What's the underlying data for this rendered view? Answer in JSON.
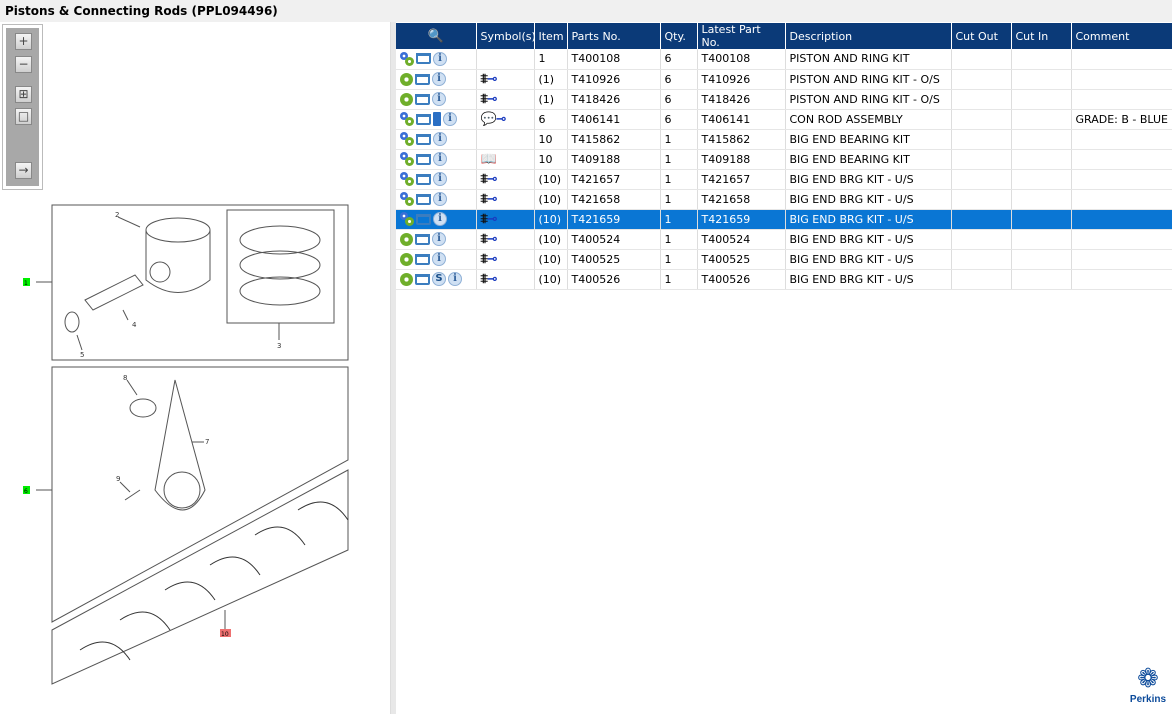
{
  "title": "Pistons & Connecting Rods (PPL094496)",
  "toolbar": {
    "zoom_in": "+",
    "zoom_out": "−",
    "fit": "⊞",
    "single": "□",
    "export": "→"
  },
  "diagram": {
    "callouts": [
      "2",
      "4",
      "5",
      "3",
      "8",
      "7",
      "9"
    ],
    "markers": [
      "1",
      "6",
      "10"
    ]
  },
  "table": {
    "headers": [
      "",
      "Symbol(s)",
      "Item",
      "Parts No.",
      "Qty.",
      "Latest Part No.",
      "Description",
      "Cut Out",
      "Cut In",
      "Comment"
    ],
    "rows": [
      {
        "icons": "gears",
        "extra": "",
        "sym": "",
        "item": "1",
        "part": "T400108",
        "qty": "6",
        "latest": "T400108",
        "desc": "PISTON AND RING KIT",
        "comment": ""
      },
      {
        "icons": "gear",
        "extra": "",
        "sym": "std",
        "item": "(1)",
        "part": "T410926",
        "qty": "6",
        "latest": "T410926",
        "desc": "PISTON AND RING KIT - O/S",
        "comment": ""
      },
      {
        "icons": "gear",
        "extra": "",
        "sym": "std",
        "item": "(1)",
        "part": "T418426",
        "qty": "6",
        "latest": "T418426",
        "desc": "PISTON AND RING KIT - O/S",
        "comment": ""
      },
      {
        "icons": "gears",
        "extra": "book",
        "sym": "note",
        "item": "6",
        "part": "T406141",
        "qty": "6",
        "latest": "T406141",
        "desc": "CON ROD ASSEMBLY",
        "comment": "GRADE: B - BLUE"
      },
      {
        "icons": "gears",
        "extra": "",
        "sym": "",
        "item": "10",
        "part": "T415862",
        "qty": "1",
        "latest": "T415862",
        "desc": "BIG END BEARING KIT",
        "comment": ""
      },
      {
        "icons": "gears",
        "extra": "",
        "sym": "kit",
        "item": "10",
        "part": "T409188",
        "qty": "1",
        "latest": "T409188",
        "desc": "BIG END BEARING KIT",
        "comment": ""
      },
      {
        "icons": "gears",
        "extra": "",
        "sym": "std",
        "item": "(10)",
        "part": "T421657",
        "qty": "1",
        "latest": "T421657",
        "desc": "BIG END BRG KIT - U/S",
        "comment": ""
      },
      {
        "icons": "gears",
        "extra": "",
        "sym": "std",
        "item": "(10)",
        "part": "T421658",
        "qty": "1",
        "latest": "T421658",
        "desc": "BIG END BRG KIT - U/S",
        "comment": ""
      },
      {
        "icons": "gears",
        "extra": "",
        "sym": "std",
        "item": "(10)",
        "part": "T421659",
        "qty": "1",
        "latest": "T421659",
        "desc": "BIG END BRG KIT - U/S",
        "comment": "",
        "selected": true
      },
      {
        "icons": "gear",
        "extra": "",
        "sym": "std",
        "item": "(10)",
        "part": "T400524",
        "qty": "1",
        "latest": "T400524",
        "desc": "BIG END BRG KIT - U/S",
        "comment": ""
      },
      {
        "icons": "gear",
        "extra": "",
        "sym": "std",
        "item": "(10)",
        "part": "T400525",
        "qty": "1",
        "latest": "T400525",
        "desc": "BIG END BRG KIT - U/S",
        "comment": ""
      },
      {
        "icons": "gear",
        "extra": "S",
        "sym": "std",
        "item": "(10)",
        "part": "T400526",
        "qty": "1",
        "latest": "T400526",
        "desc": "BIG END BRG KIT - U/S",
        "comment": ""
      }
    ]
  },
  "logo": {
    "text": "Perkins"
  },
  "colors": {
    "header": "#0b3a78",
    "selected": "#0a76d4"
  }
}
